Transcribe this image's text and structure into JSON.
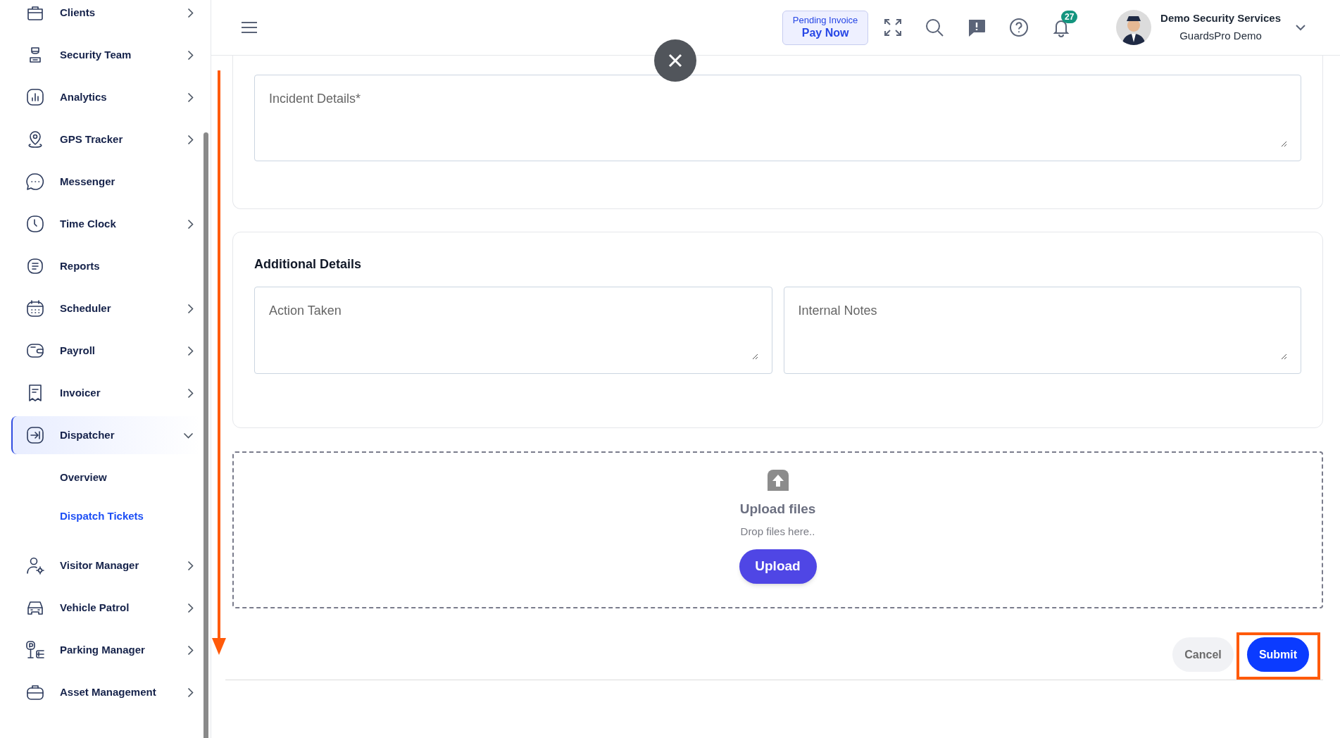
{
  "sidebar": {
    "items": [
      {
        "label": "Clients",
        "expanded": false,
        "selected": false
      },
      {
        "label": "Security Team",
        "expanded": false,
        "selected": false
      },
      {
        "label": "Analytics",
        "expanded": false,
        "selected": false
      },
      {
        "label": "GPS Tracker",
        "expanded": false,
        "selected": false
      },
      {
        "label": "Messenger",
        "selected": false
      },
      {
        "label": "Time Clock",
        "expanded": false,
        "selected": false
      },
      {
        "label": "Reports",
        "selected": false
      },
      {
        "label": "Scheduler",
        "expanded": false,
        "selected": false
      },
      {
        "label": "Payroll",
        "expanded": false,
        "selected": false
      },
      {
        "label": "Invoicer",
        "expanded": false,
        "selected": false
      },
      {
        "label": "Dispatcher",
        "expanded": true,
        "selected": true,
        "children": [
          {
            "label": "Overview",
            "selected": false
          },
          {
            "label": "Dispatch Tickets",
            "selected": true
          }
        ]
      },
      {
        "label": "Visitor Manager",
        "expanded": false,
        "selected": false
      },
      {
        "label": "Vehicle Patrol",
        "expanded": false,
        "selected": false
      },
      {
        "label": "Parking Manager",
        "expanded": false,
        "selected": false
      },
      {
        "label": "Asset Management",
        "expanded": false,
        "selected": false
      }
    ]
  },
  "header": {
    "invoice_notice": {
      "label": "Pending Invoice",
      "action": "Pay Now"
    },
    "notification_count": "27",
    "user": {
      "name": "Demo Security Services",
      "company": "GuardsPro Demo"
    }
  },
  "form": {
    "incident_details": {
      "placeholder": "Incident Details*"
    },
    "additional_details": {
      "title": "Additional Details",
      "fields": [
        {
          "placeholder": "Action Taken"
        },
        {
          "placeholder": "Internal Notes"
        }
      ]
    },
    "upload": {
      "title": "Upload files",
      "hint": "Drop files here..",
      "button": "Upload"
    },
    "buttons": {
      "cancel": "Cancel",
      "submit": "Submit"
    }
  }
}
